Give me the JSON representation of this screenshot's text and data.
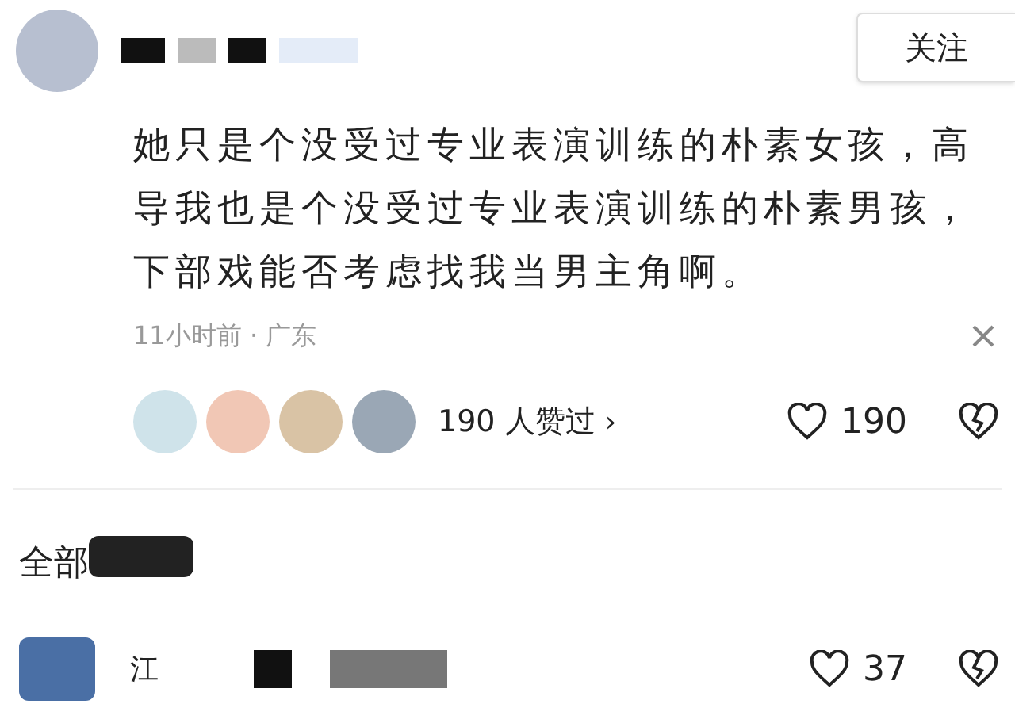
{
  "post": {
    "follow_button": "关注",
    "text": "她只是个没受过专业表演训练的朴素女孩，高导我也是个没受过专业表演训练的朴素男孩，下部戏能否考虑找我当男主角啊。",
    "meta": "11小时前 · 广东",
    "likers": "190 人赞过",
    "likers_chevron": "›",
    "like_count": "190"
  },
  "replies": {
    "heading": "全部",
    "first_reply": {
      "name_start": "江",
      "like_count": "37"
    }
  }
}
